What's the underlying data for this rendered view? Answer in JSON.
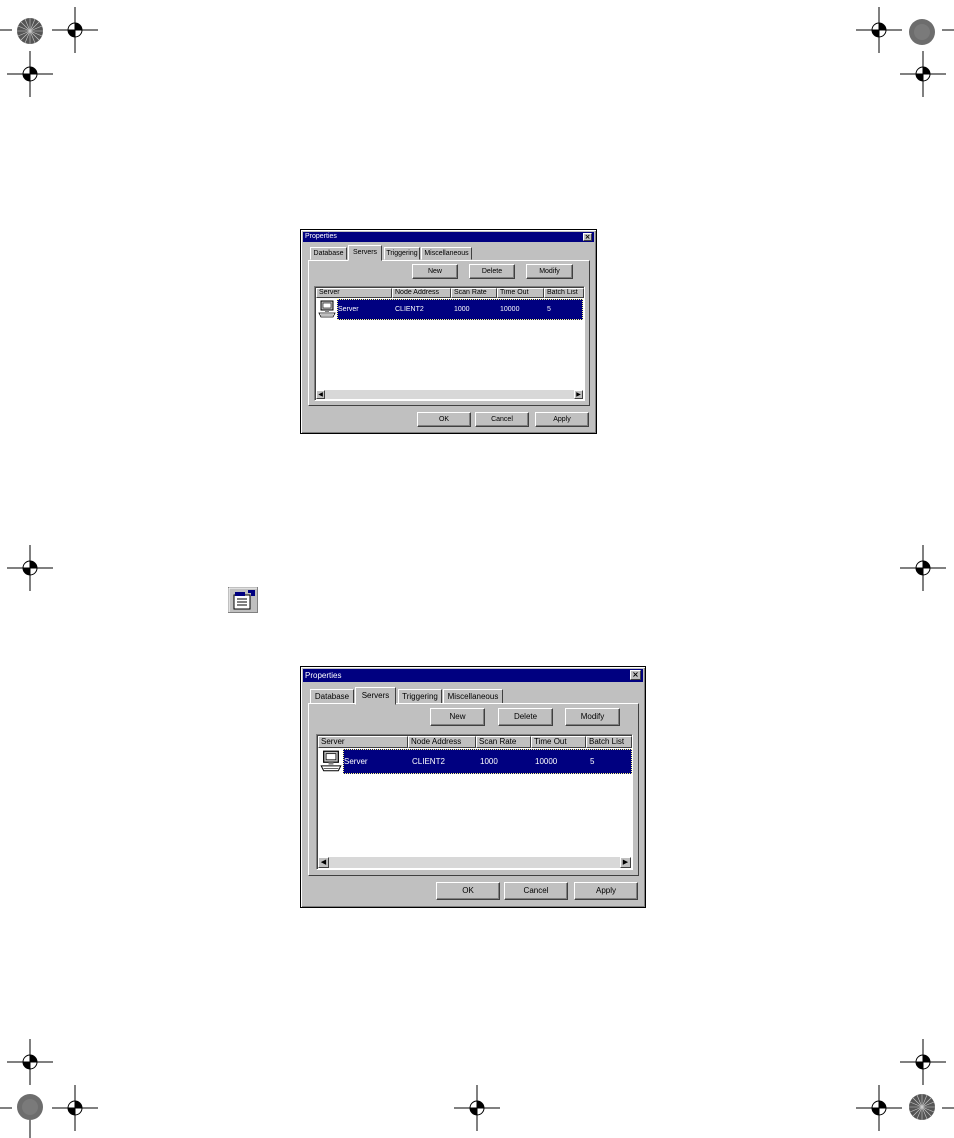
{
  "dialog_small": {
    "title": "Properties",
    "close_glyph": "×",
    "tabs": [
      "Database",
      "Servers",
      "Triggering",
      "Miscellaneous"
    ],
    "buttons": {
      "new": "New",
      "delete": "Delete",
      "modify": "Modify"
    },
    "columns": [
      "Server",
      "Node Address",
      "Scan Rate",
      "Time Out",
      "Batch List"
    ],
    "row": {
      "server": "Server",
      "node_address": "CLIENT2",
      "scan_rate": "1000",
      "time_out": "10000",
      "batch_list": "5"
    },
    "footer": {
      "ok": "OK",
      "cancel": "Cancel",
      "apply": "Apply"
    },
    "scroll_left": "◀",
    "scroll_right": "▶"
  },
  "dialog_large": {
    "title": "Properties",
    "close_glyph": "×",
    "tabs": [
      "Database",
      "Servers",
      "Triggering",
      "Miscellaneous"
    ],
    "buttons": {
      "new": "New",
      "delete": "Delete",
      "modify": "Modify"
    },
    "columns": [
      "Server",
      "Node Address",
      "Scan Rate",
      "Time Out",
      "Batch List"
    ],
    "row": {
      "server": "Server",
      "node_address": "CLIENT2",
      "scan_rate": "1000",
      "time_out": "10000",
      "batch_list": "5"
    },
    "footer": {
      "ok": "OK",
      "cancel": "Cancel",
      "apply": "Apply"
    },
    "scroll_left": "◀",
    "scroll_right": "▶"
  },
  "toolbar_icon": "properties-toolbar-icon",
  "colors": {
    "title_bar": "#000080",
    "selection": "#000080",
    "face": "#c0c0c0"
  }
}
